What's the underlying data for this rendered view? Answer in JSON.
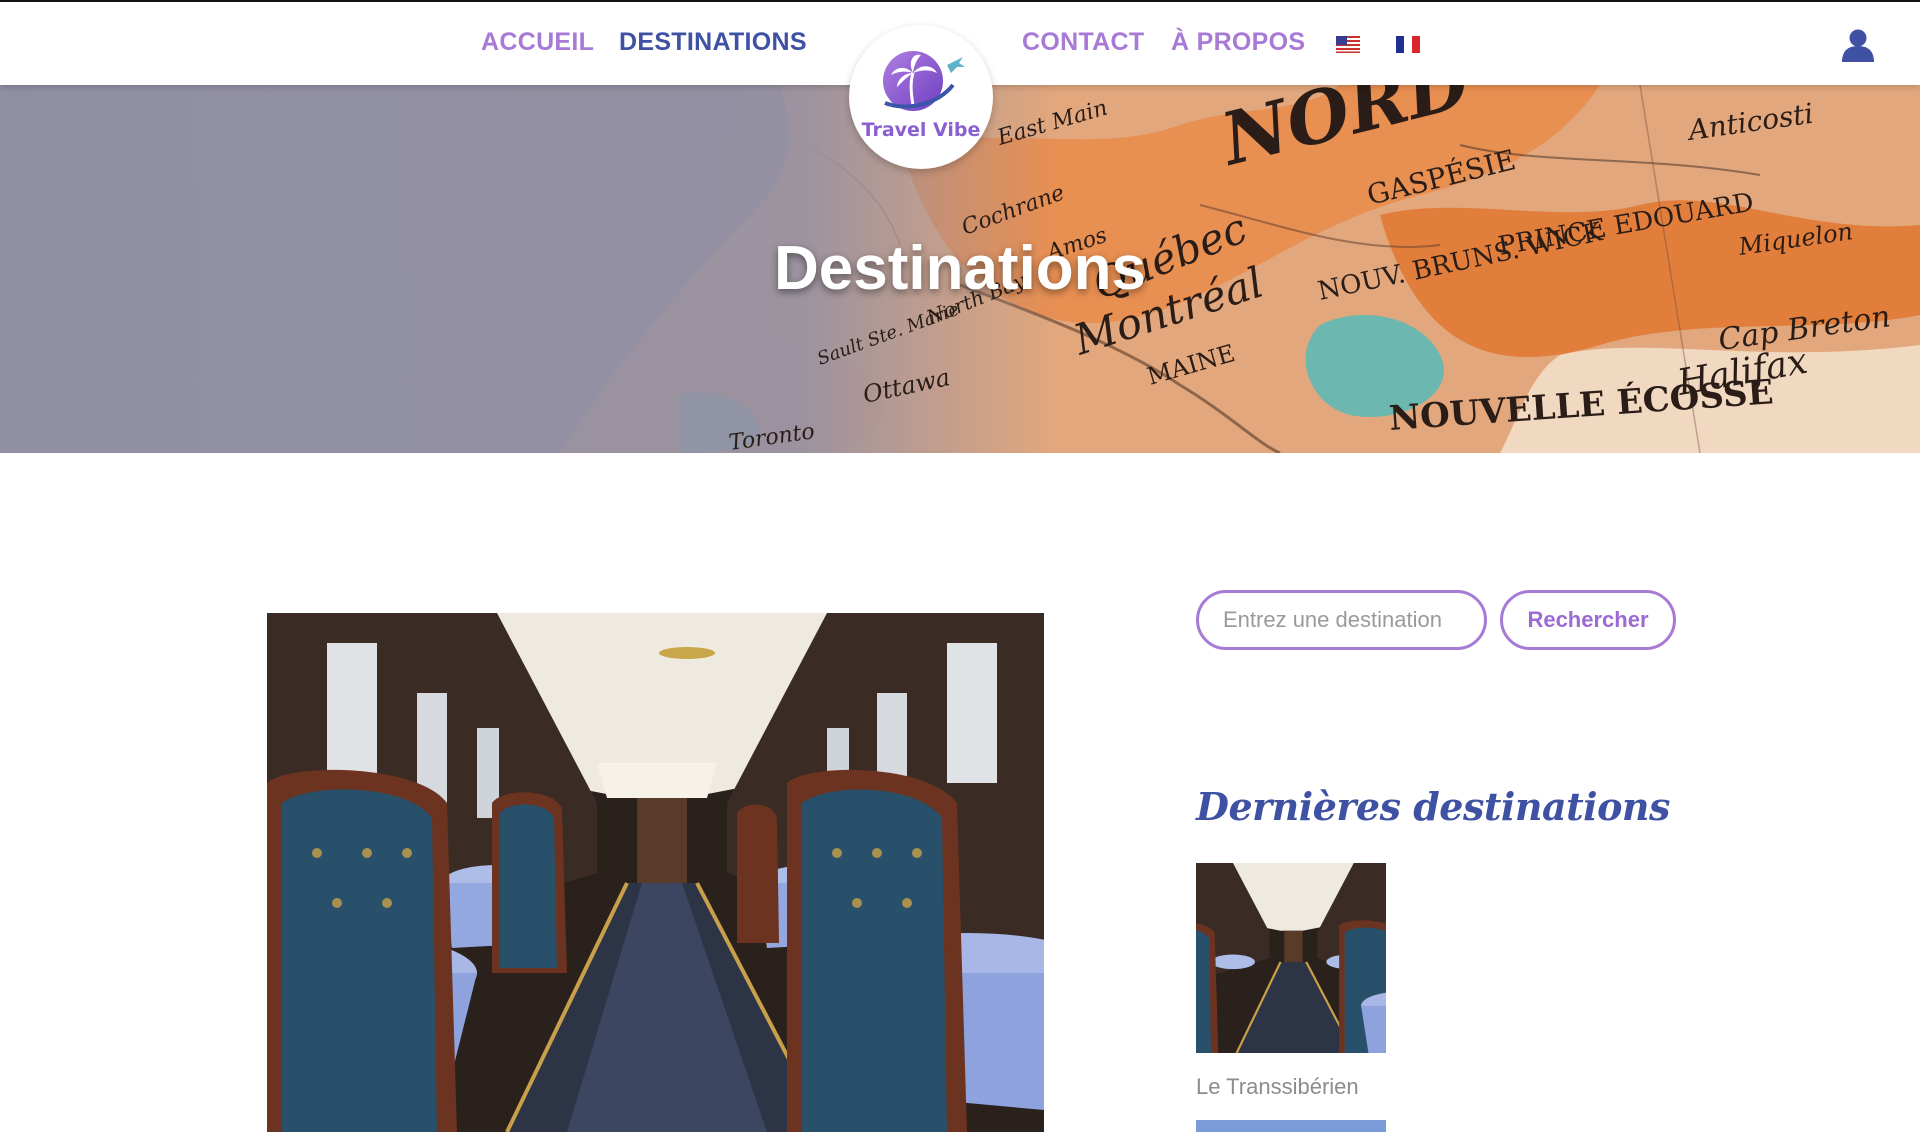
{
  "nav": {
    "items": [
      {
        "label": "ACCUEIL",
        "active": false
      },
      {
        "label": "DESTINATIONS",
        "active": true
      },
      {
        "label": "CONTACT",
        "active": false
      },
      {
        "label": "À PROPOS",
        "active": false
      }
    ],
    "languages": [
      "en-us-flag",
      "fr-flag"
    ],
    "user_icon": "user-icon"
  },
  "logo": {
    "text": "Travel Vibe"
  },
  "hero": {
    "title": "Destinations",
    "map_labels": [
      "NORD",
      "Québec",
      "Montréal",
      "Ottawa",
      "NOUV. BRUNS. WICK",
      "PRINCE EDOUARD",
      "NOUVELLE ÉCOSSE",
      "Halifax",
      "MAINE",
      "GASPÉSIE",
      "Toronto",
      "Anticosti",
      "Miquelon",
      "Cap Breton",
      "Amos",
      "Cochrane",
      "North Bay",
      "Sault Ste. Marie",
      "East Main"
    ]
  },
  "search": {
    "placeholder": "Entrez une destination",
    "button_label": "Rechercher"
  },
  "sidebar": {
    "heading": "Dernières destinations",
    "recent": [
      {
        "title": "Le Transsibérien"
      }
    ]
  },
  "colors": {
    "accent_purple": "#a77ad6",
    "nav_active_blue": "#3f51a3",
    "hero_title": "#ffffff",
    "muted_text": "#8c8c8c"
  }
}
